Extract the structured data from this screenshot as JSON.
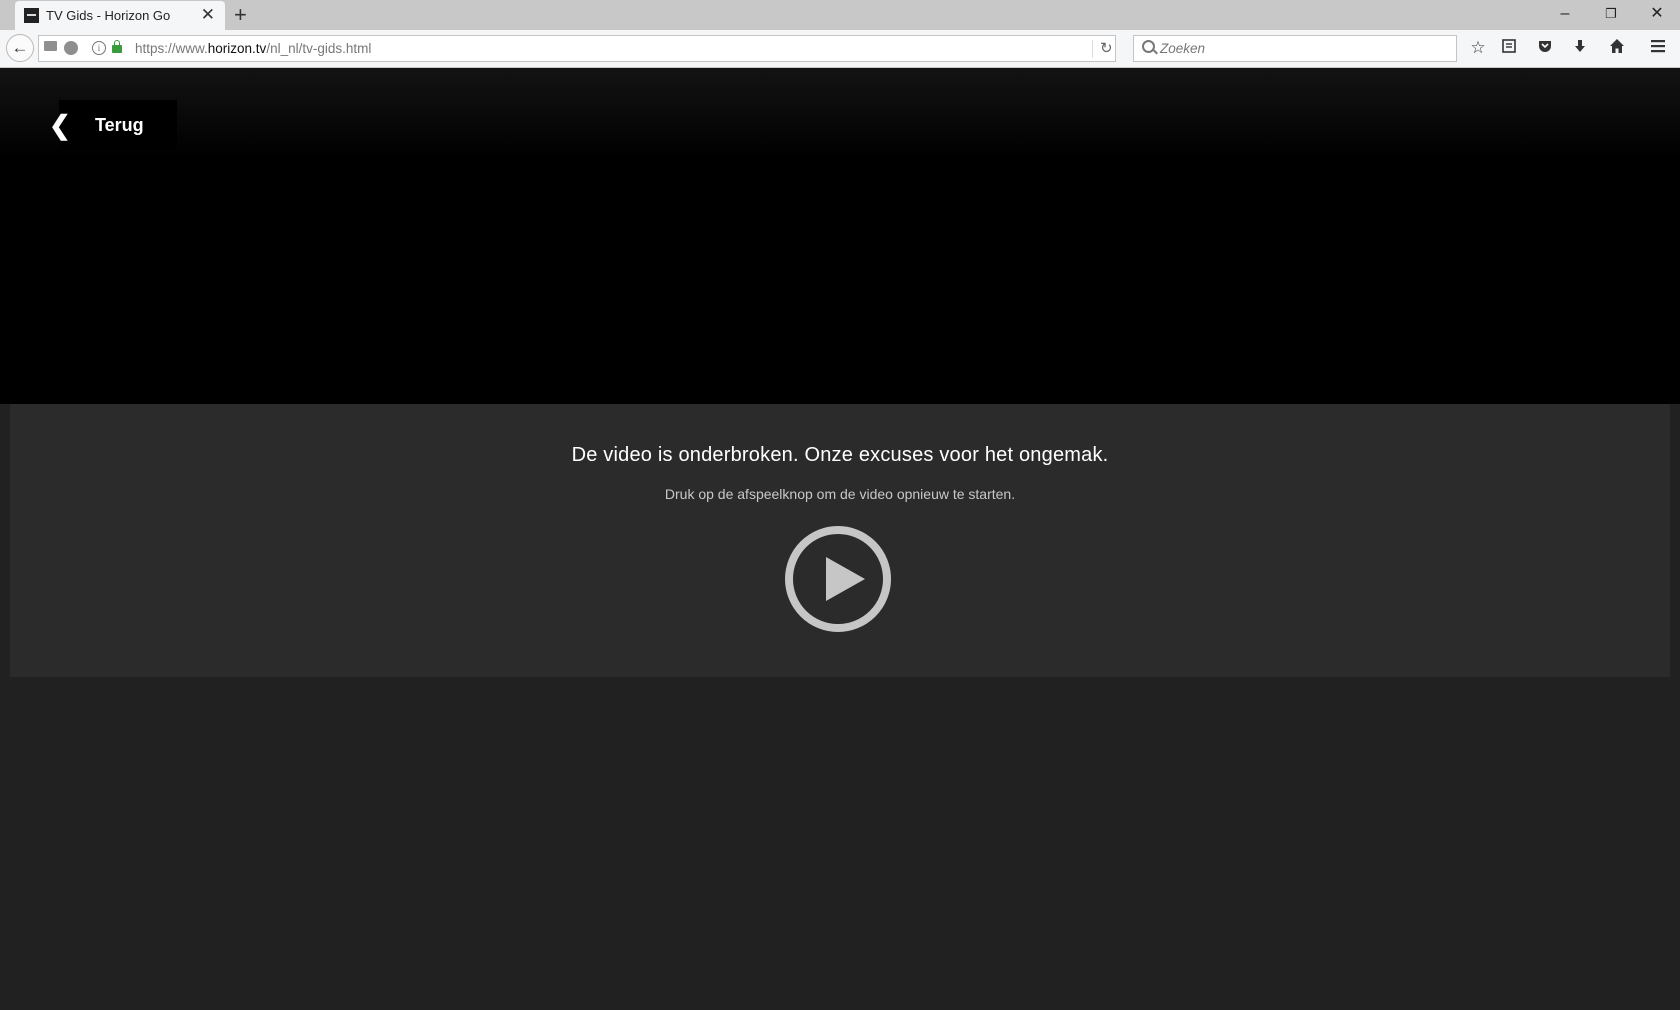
{
  "browser": {
    "tab_title": "TV Gids - Horizon Go",
    "new_tab": "+",
    "url_prefix": "https://www.",
    "url_host": "horizon.tv",
    "url_path": "/nl_nl/tv-gids.html",
    "search_placeholder": "Zoeken",
    "window_controls": {
      "minimize": "–",
      "restore": "❐",
      "close": "✕"
    }
  },
  "player": {
    "back_label": "Terug",
    "back_icon": "chevron-left-icon",
    "error_title": "De video is onderbroken. Onze excuses voor het ongemak.",
    "error_message": "Druk op de afspeelknop om de video opnieuw te starten.",
    "play_icon": "play-circle-icon"
  },
  "colors": {
    "page_background": "#212121",
    "panel_background": "#2b2b2b",
    "video_background": "#000000",
    "play_icon": "#c6c6c6"
  }
}
